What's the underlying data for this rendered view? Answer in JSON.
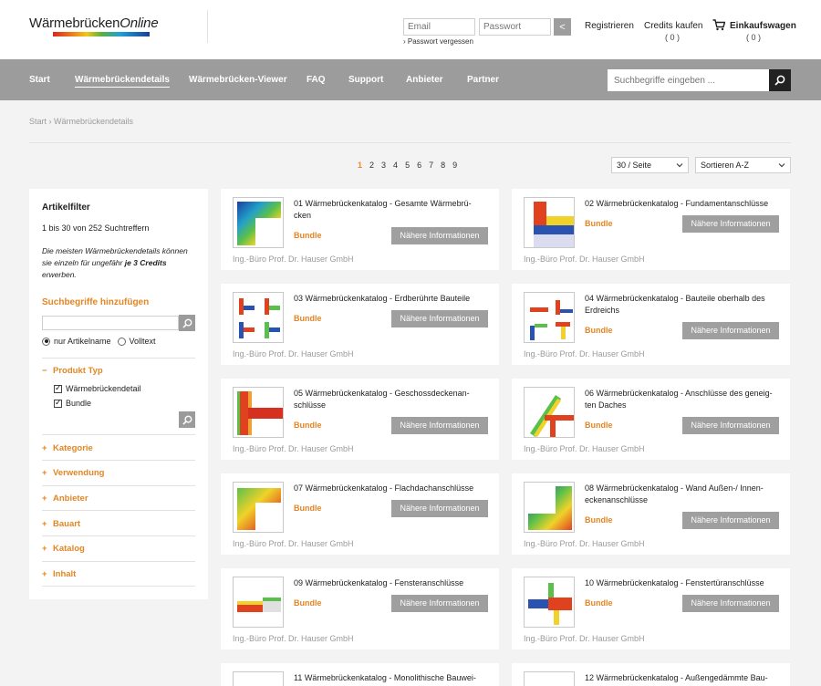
{
  "header": {
    "logo_main": "Wärmebrücken",
    "logo_italic": "Online",
    "email_placeholder": "Email",
    "password_placeholder": "Passwort",
    "login_go": "<",
    "forgot_password": "› Passwort vergessen",
    "register": "Registrieren",
    "credits": "Credits kaufen",
    "credits_count": "( 0 )",
    "cart": "Einkaufswagen",
    "cart_count": "( 0 )"
  },
  "nav": {
    "items": [
      "Start",
      "Wärmebrückendetails",
      "Wärmebrücken-Viewer",
      "FAQ",
      "Support",
      "Anbieter",
      "Partner"
    ],
    "search_placeholder": "Suchbegriffe eingeben ..."
  },
  "breadcrumb": "Start › Wärmebrückendetails",
  "pagination": {
    "current": "1",
    "pages": [
      "2",
      "3",
      "4",
      "5",
      "6",
      "7",
      "8",
      "9"
    ]
  },
  "per_page": "30 / Seite",
  "sort": "Sortieren A-Z",
  "sidebar": {
    "title": "Artikelfilter",
    "result_count": "1 bis 30 von 252 Suchtreffern",
    "note_pre": "Die meisten Wärmebrückendetails können sie einzeln für ungefähr ",
    "note_bold": "je 3 Credits",
    "note_post": " erwerben.",
    "add_terms": "Suchbegriffe hinzufügen",
    "radio_article": "nur Artikelname",
    "radio_full": "Volltext",
    "product_type": "Produkt Typ",
    "type_detail": "Wärmebrückendetail",
    "type_bundle": "Bundle",
    "collapsed": [
      "Kategorie",
      "Verwendung",
      "Anbieter",
      "Bauart",
      "Katalog",
      "Inhalt"
    ],
    "minus": "−",
    "plus": "+"
  },
  "cards_common": {
    "bundle": "Bundle",
    "info": "Nähere Informationen",
    "vendor": "Ing.-Büro Prof. Dr. Hauser GmbH"
  },
  "cards": [
    {
      "title": "01 Wärmebrückenkatalog - Gesamte Wärmebrü-cken"
    },
    {
      "title": "02 Wärmebrückenkatalog - Fundamentanschlüsse"
    },
    {
      "title": "03 Wärmebrückenkatalog - Erdberührte Bauteile"
    },
    {
      "title": "04 Wärmebrückenkatalog - Bauteile oberhalb des Erdreichs"
    },
    {
      "title": "05 Wärmebrückenkatalog - Geschossdeckenan-schlüsse"
    },
    {
      "title": "06 Wärmebrückenkatalog - Anschlüsse des geneig-ten Daches"
    },
    {
      "title": "07 Wärmebrückenkatalog - Flachdachanschlüsse"
    },
    {
      "title": "08 Wärmebrückenkatalog - Wand Außen-/ Innen-eckenanschlüsse"
    },
    {
      "title": "09 Wärmebrückenkatalog - Fensteranschlüsse"
    },
    {
      "title": "10 Wärmebrückenkatalog - Fenstertüranschlüsse"
    },
    {
      "title": "11 Wärmebrückenkatalog - Monolithische Bauwei-"
    },
    {
      "title": "12 Wärmebrückenkatalog - Außengedämmte Bau-"
    }
  ],
  "colors": {
    "accent": "#e38624",
    "nav": "#9c9c9c",
    "button": "#9f9f9f"
  }
}
